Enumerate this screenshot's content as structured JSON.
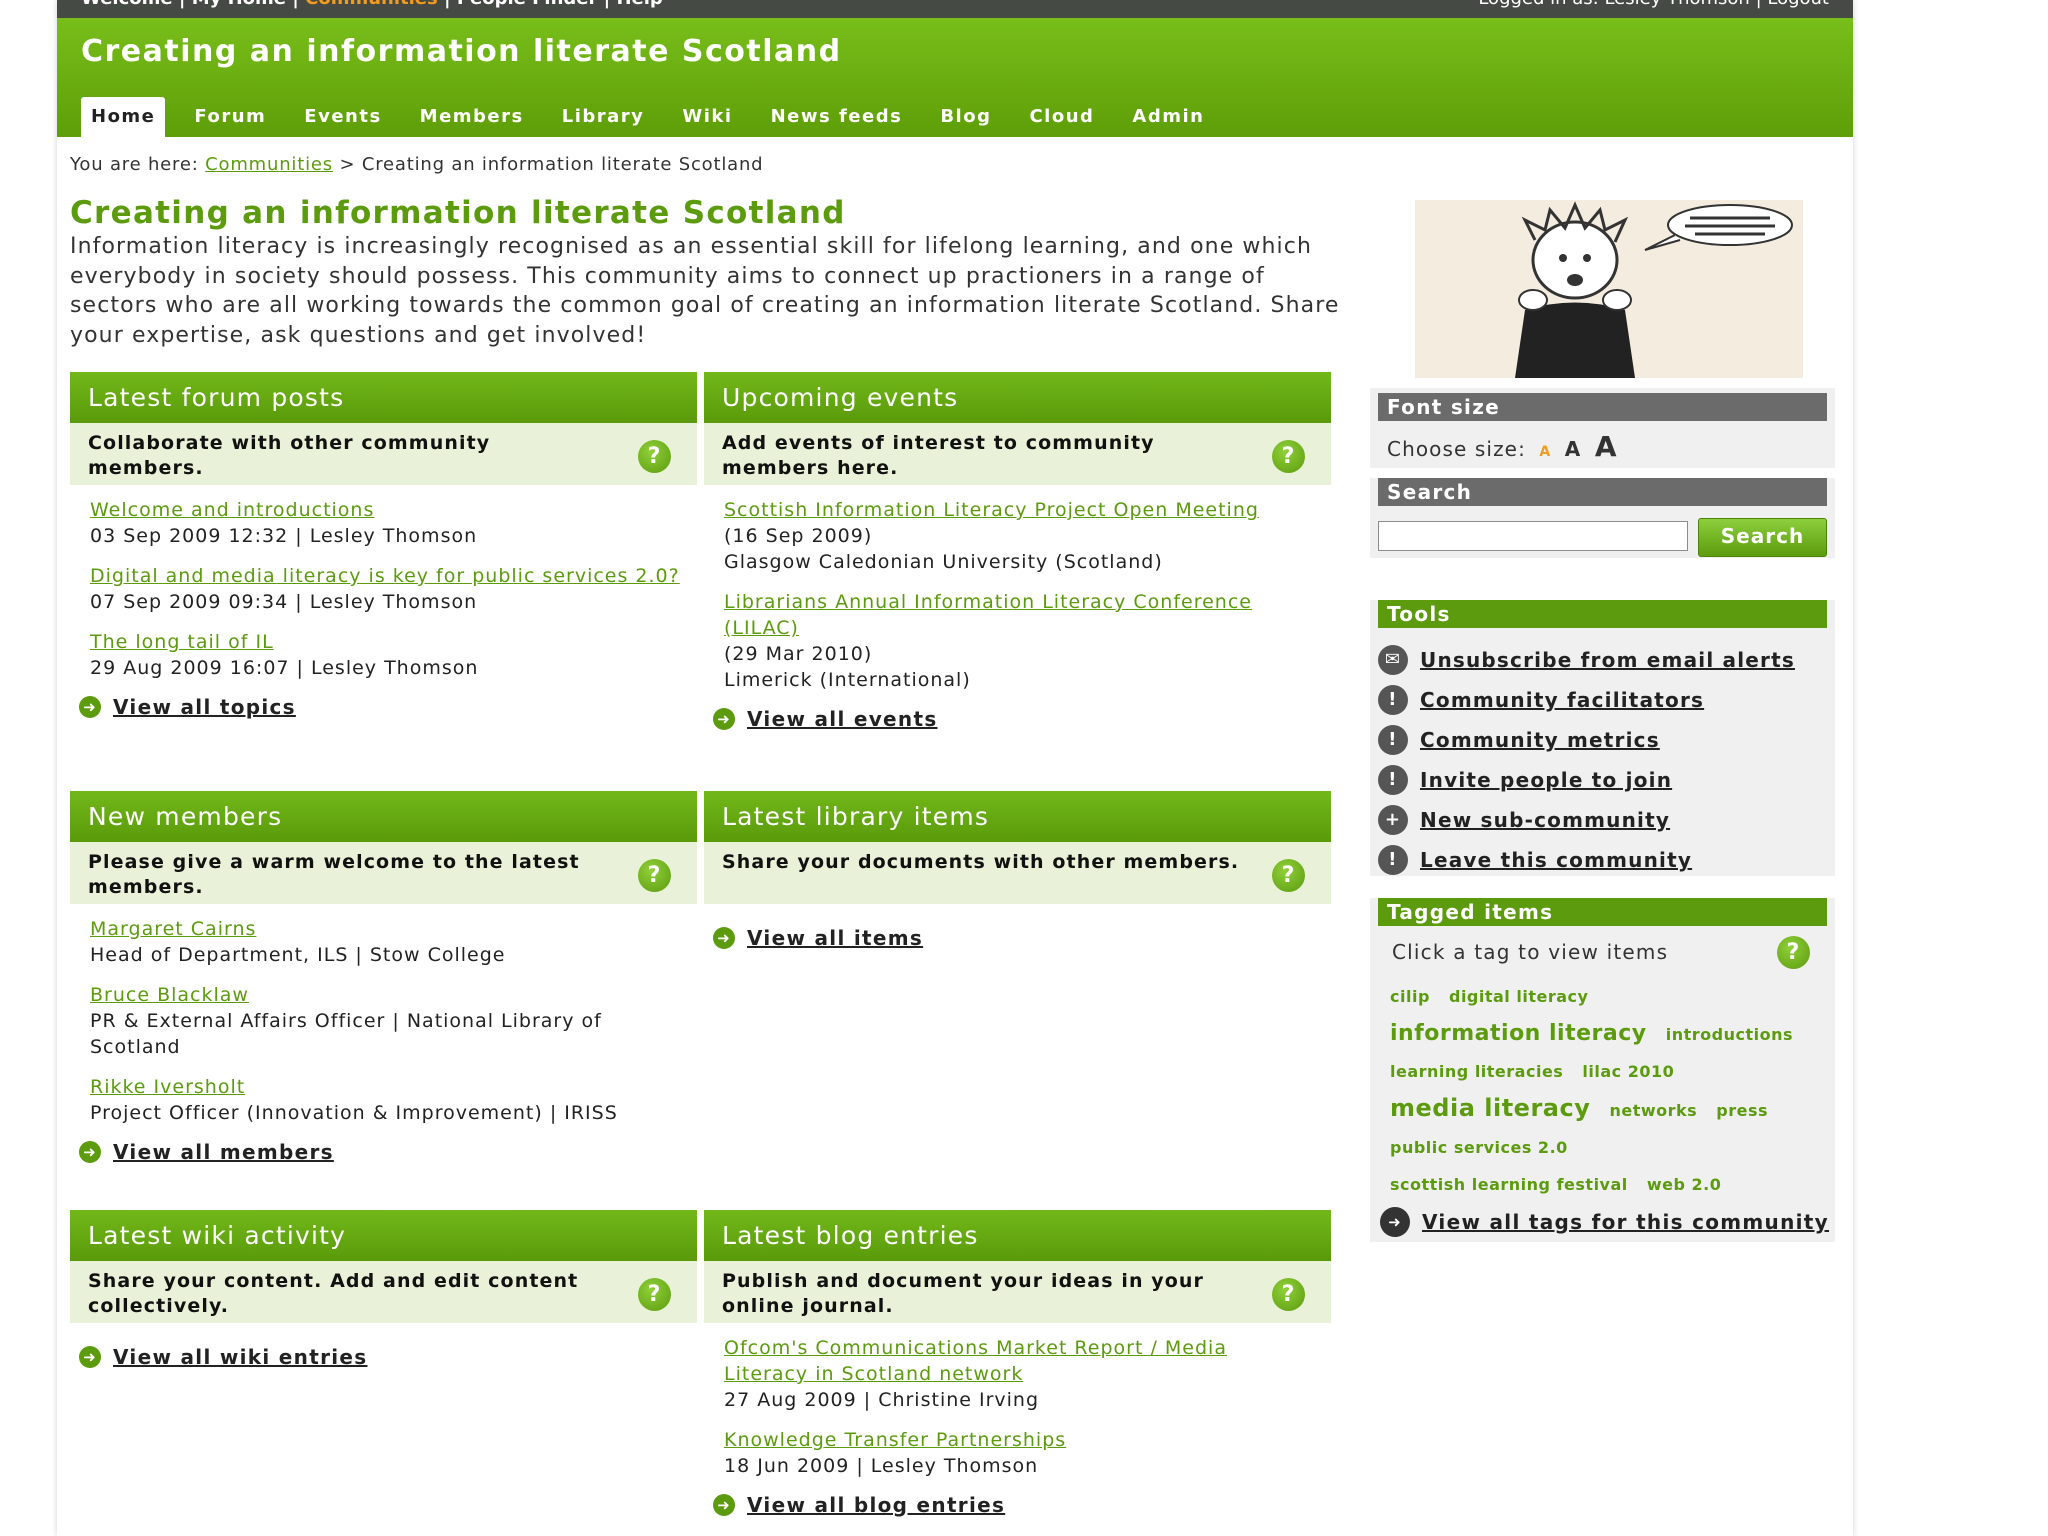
{
  "topbar": {
    "links": [
      "Welcome",
      "My Home",
      "Communities",
      "People Finder",
      "Help"
    ],
    "logged_in": "Logged in as: Lesley Thomson",
    "logout": "Logout"
  },
  "site_title": "Creating an information literate Scotland",
  "nav": [
    "Home",
    "Forum",
    "Events",
    "Members",
    "Library",
    "Wiki",
    "News feeds",
    "Blog",
    "Cloud",
    "Admin"
  ],
  "breadcrumb": {
    "prefix": "You are here:",
    "link": "Communities",
    "separator": ">",
    "current": "Creating an information literate Scotland"
  },
  "main": {
    "title": "Creating an information literate Scotland",
    "intro": "Information literacy is increasingly recognised as an essential skill for lifelong learning, and one which everybody in society should possess. This community aims to connect up practioners in a range of sectors who are all working towards the common goal of creating an information literate Scotland. Share your expertise, ask questions and get involved!"
  },
  "forum": {
    "title": "Latest forum posts",
    "subtitle": "Collaborate with other community members.",
    "items": [
      {
        "title": "Welcome and introductions",
        "meta": "03 Sep 2009 12:32 | Lesley Thomson"
      },
      {
        "title": "Digital and media literacy is key for public services 2.0?",
        "meta": "07 Sep 2009 09:34 | Lesley Thomson"
      },
      {
        "title": "The long tail of IL",
        "meta": "29 Aug 2009 16:07 | Lesley Thomson"
      }
    ],
    "view_all": "View all topics"
  },
  "events": {
    "title": "Upcoming events",
    "subtitle": "Add events of interest to community members here.",
    "items": [
      {
        "title": "Scottish Information Literacy Project Open Meeting",
        "date": "(16 Sep 2009)",
        "place": "Glasgow Caledonian University (Scotland)"
      },
      {
        "title": "Librarians Annual Information Literacy Conference (LILAC)",
        "date": "(29 Mar 2010)",
        "place": "Limerick (International)"
      }
    ],
    "view_all": "View all events"
  },
  "members": {
    "title": "New members",
    "subtitle": "Please give a warm welcome to the latest members.",
    "items": [
      {
        "name": "Margaret Cairns",
        "role": "Head of Department, ILS | Stow College"
      },
      {
        "name": "Bruce Blacklaw",
        "role": "PR & External Affairs Officer | National Library of Scotland"
      },
      {
        "name": "Rikke Iversholt",
        "role": "Project Officer (Innovation & Improvement) | IRISS"
      }
    ],
    "view_all": "View all members"
  },
  "library": {
    "title": "Latest library items",
    "subtitle": "Share your documents with other members.",
    "view_all": "View all items"
  },
  "wiki": {
    "title": "Latest wiki activity",
    "subtitle": "Share your content. Add and edit content collectively.",
    "view_all": "View all wiki entries"
  },
  "blog": {
    "title": "Latest blog entries",
    "subtitle": "Publish and document your ideas in your online journal.",
    "items": [
      {
        "title": "Ofcom's Communications Market Report / Media Literacy in Scotland network",
        "meta": "27 Aug 2009 | Christine Irving"
      },
      {
        "title": "Knowledge Transfer Partnerships",
        "meta": "18 Jun 2009 | Lesley Thomson"
      }
    ],
    "view_all": "View all blog entries"
  },
  "sidebar": {
    "font_size": {
      "title": "Font size",
      "label": "Choose size:",
      "small": "A",
      "medium": "A",
      "large": "A"
    },
    "search": {
      "title": "Search",
      "button": "Search",
      "value": ""
    },
    "tools": {
      "title": "Tools",
      "items": [
        {
          "label": "Unsubscribe from email alerts",
          "icon": "envelope-icon"
        },
        {
          "label": "Community facilitators",
          "icon": "exclamation-icon"
        },
        {
          "label": "Community metrics",
          "icon": "exclamation-icon"
        },
        {
          "label": "Invite people to join",
          "icon": "exclamation-icon"
        },
        {
          "label": "New sub-community",
          "icon": "plus-icon"
        },
        {
          "label": "Leave this community",
          "icon": "exclamation-icon"
        }
      ]
    },
    "tagged": {
      "title": "Tagged items",
      "intro": "Click a tag to view items",
      "tags": [
        "cilip",
        "digital literacy",
        "information literacy",
        "introductions",
        "learning literacies",
        "lilac 2010",
        "media literacy",
        "networks",
        "press",
        "public services 2.0",
        "scottish learning festival",
        "web 2.0"
      ],
      "view_all": "View all tags for this community"
    }
  },
  "colors": {
    "brand_green": "#5c9b0e",
    "accent_orange": "#f39b1e",
    "topbar": "#454a45"
  }
}
